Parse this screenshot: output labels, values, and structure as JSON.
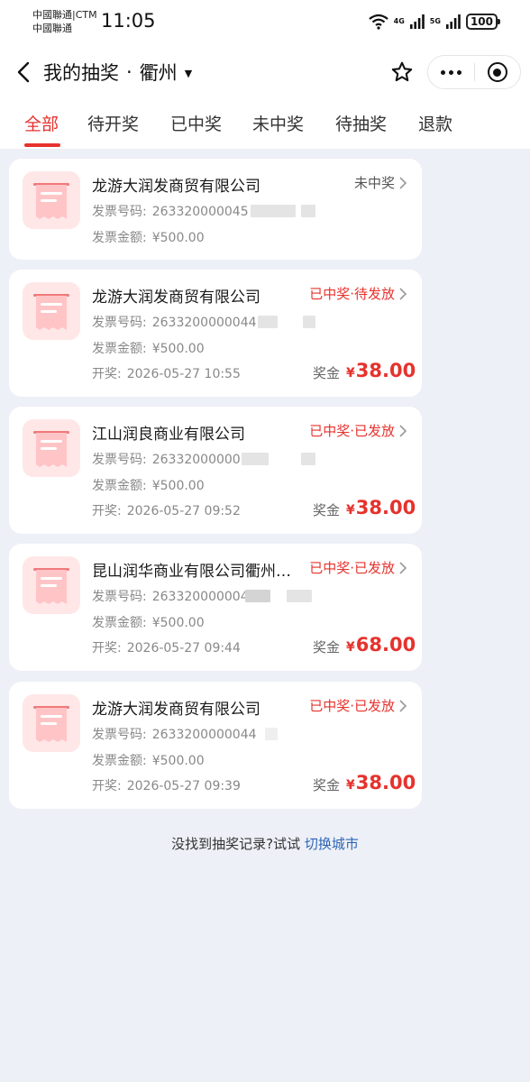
{
  "status_bar": {
    "carrier_line1": "中國聯通|CTM",
    "carrier_line2": "中國聯通",
    "time": "11:05",
    "net1": "4G",
    "net2": "5G",
    "battery": "100"
  },
  "nav": {
    "title": "我的抽奖",
    "separator": "·",
    "city": "衢州",
    "caret": "▼"
  },
  "tabs": [
    {
      "label": "全部"
    },
    {
      "label": "待开奖"
    },
    {
      "label": "已中奖"
    },
    {
      "label": "未中奖"
    },
    {
      "label": "待抽奖"
    },
    {
      "label": "退款"
    }
  ],
  "labels": {
    "invoice_no": "发票号码:",
    "invoice_amount": "发票金额:",
    "draw_time": "开奖:",
    "prize": "奖金",
    "currency": "¥"
  },
  "records": [
    {
      "company": "龙游大润发商贸有限公司",
      "status": "未中奖",
      "invoice_no": "263320000045",
      "amount": "¥500.00"
    },
    {
      "company": "龙游大润发商贸有限公司",
      "status": "已中奖·待发放",
      "invoice_no": "2633200000044",
      "amount": "¥500.00",
      "draw_time": "2026-05-27 10:55",
      "prize": "38.00"
    },
    {
      "company": "江山润良商业有限公司",
      "status": "已中奖·已发放",
      "invoice_no": "263320000001",
      "amount": "¥500.00",
      "draw_time": "2026-05-27 09:52",
      "prize": "38.00"
    },
    {
      "company": "昆山润华商业有限公司衢州分公司",
      "status": "已中奖·已发放",
      "invoice_no": "2633200000044",
      "amount": "¥500.00",
      "draw_time": "2026-05-27 09:44",
      "prize": "68.00"
    },
    {
      "company": "龙游大润发商贸有限公司",
      "status": "已中奖·已发放",
      "invoice_no": "2633200000044",
      "amount": "¥500.00",
      "draw_time": "2026-05-27 09:39",
      "prize": "38.00"
    }
  ],
  "footer": {
    "text": "没找到抽奖记录?试试 ",
    "link": "切换城市"
  },
  "colors": {
    "accent": "#e6322d",
    "link": "#2e66b8",
    "background": "#eef0f7"
  }
}
